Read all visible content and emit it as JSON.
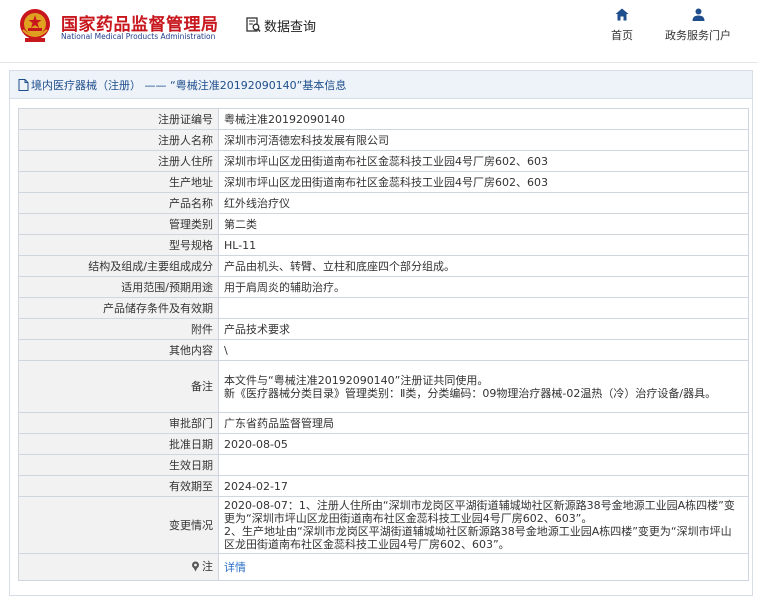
{
  "header": {
    "site_name_cn": "国家药品监督管理局",
    "site_name_en": "National Medical Products Administration",
    "query_label": "数据查询",
    "nav": [
      {
        "label": "首页",
        "icon": "home-icon"
      },
      {
        "label": "政务服务门户",
        "icon": "user-icon"
      }
    ]
  },
  "breadcrumb": {
    "category": "境内医疗器械（注册）",
    "separator": " —— ",
    "record": "“粤械注准20192090140”基本信息"
  },
  "info": {
    "rows": [
      {
        "label": "注册证编号",
        "value": "粤械注准20192090140"
      },
      {
        "label": "注册人名称",
        "value": "深圳市河浯德宏科技发展有限公司"
      },
      {
        "label": "注册人住所",
        "value": "深圳市坪山区龙田街道南布社区金蕊科技工业园4号厂房602、603"
      },
      {
        "label": "生产地址",
        "value": "深圳市坪山区龙田街道南布社区金蕊科技工业园4号厂房602、603"
      },
      {
        "label": "产品名称",
        "value": "红外线治疗仪"
      },
      {
        "label": "管理类别",
        "value": "第二类"
      },
      {
        "label": "型号规格",
        "value": "HL-11"
      },
      {
        "label": "结构及组成/主要组成成分",
        "value": "产品由机头、转臂、立柱和底座四个部分组成。"
      },
      {
        "label": "适用范围/预期用途",
        "value": "用于肩周炎的辅助治疗。"
      },
      {
        "label": "产品储存条件及有效期",
        "value": ""
      },
      {
        "label": "附件",
        "value": "产品技术要求"
      },
      {
        "label": "其他内容",
        "value": "\\"
      }
    ],
    "remark": {
      "label": "备注",
      "lines": [
        "本文件与“粤械注准20192090140”注册证共同使用。",
        "新《医疗器械分类目录》管理类别：Ⅱ类，分类编码：09物理治疗器械-02温热（冷）治疗设备/器具。"
      ]
    },
    "rows2": [
      {
        "label": "审批部门",
        "value": "广东省药品监督管理局"
      },
      {
        "label": "批准日期",
        "value": "2020-08-05"
      },
      {
        "label": "生效日期",
        "value": ""
      },
      {
        "label": "有效期至",
        "value": "2024-02-17"
      }
    ],
    "change": {
      "label": "变更情况",
      "lines": [
        "2020-08-07：1、注册人住所由“深圳市龙岗区平湖街道辅城坳社区新源路38号金地源工业园A栋四楼”变更为“深圳市坪山区龙田街道南布社区金蕊科技工业园4号厂房602、603”。",
        "2、生产地址由“深圳市龙岗区平湖街道辅城坳社区新源路38号金地源工业园A栋四楼”变更为“深圳市坪山区龙田街道南布社区金蕊科技工业园4号厂房602、603”。"
      ]
    },
    "note": {
      "label": "注",
      "icon": "pin-icon",
      "link": "详情"
    }
  },
  "colors": {
    "brand_red": "#c8161d",
    "brand_blue": "#1f3e8c",
    "link": "#2a6ec6",
    "label_bg": "#f2f2f2",
    "crumb_bg": "#eef3f9"
  }
}
